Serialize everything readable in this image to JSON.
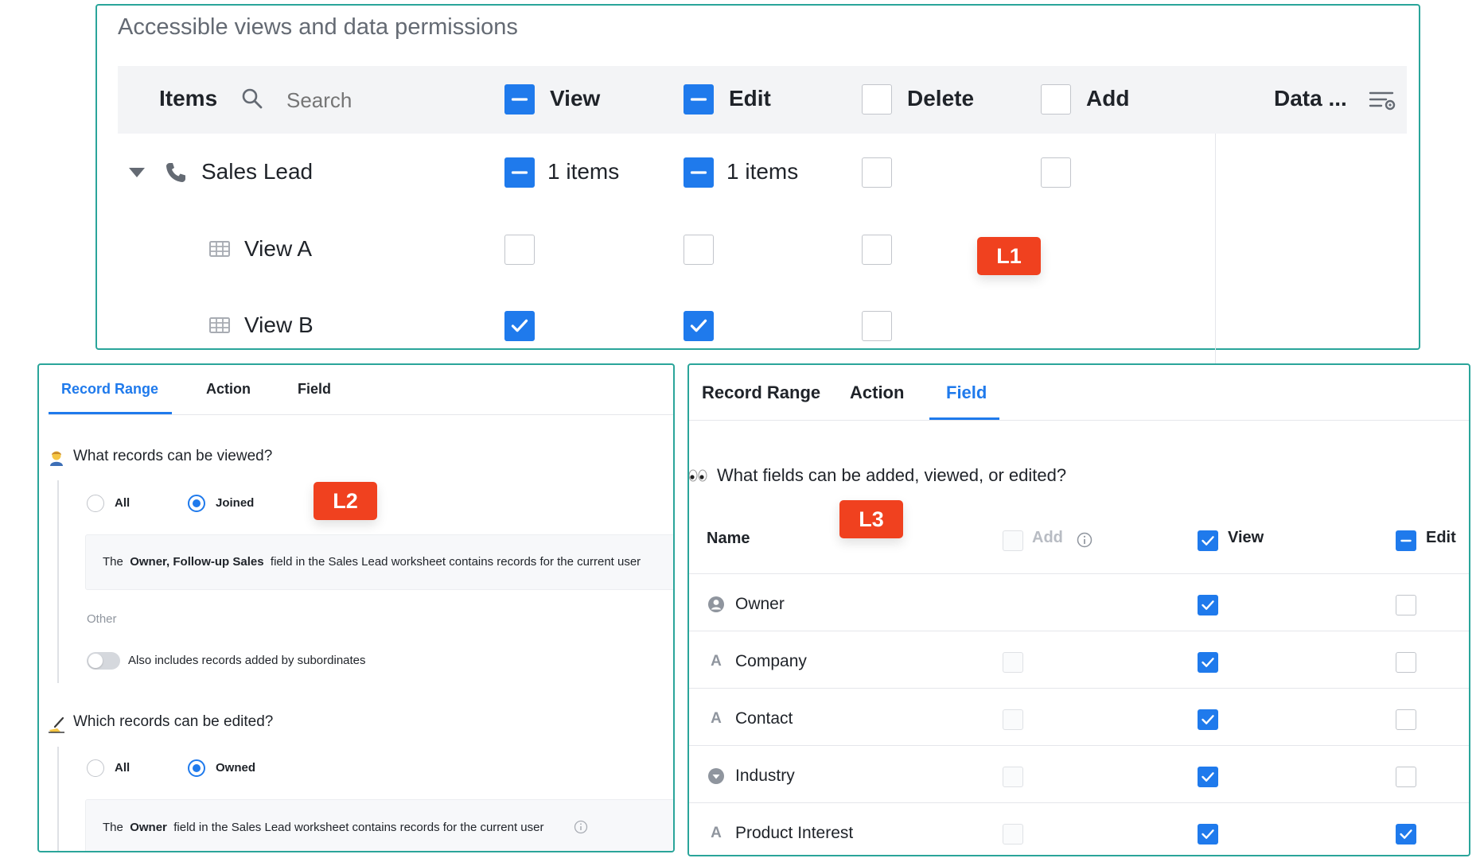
{
  "panel1": {
    "title": "Accessible views and data permissions",
    "header": {
      "items_label": "Items",
      "search_placeholder": "Search",
      "view_label": "View",
      "edit_label": "Edit",
      "delete_label": "Delete",
      "add_label": "Add",
      "data_label": "Data ..."
    },
    "rows": [
      {
        "label": "Sales Lead",
        "view_text": "1 items",
        "edit_text": "1 items"
      },
      {
        "label": "View A"
      },
      {
        "label": "View B"
      }
    ],
    "marker": "L1"
  },
  "panel2": {
    "tabs": [
      "Record Range",
      "Action",
      "Field"
    ],
    "active_tab": "Record Range",
    "q1": "What records can be viewed?",
    "q1_options": [
      "All",
      "Joined"
    ],
    "q1_selected": "Joined",
    "q1_info": {
      "prefix": "The",
      "bold": "Owner, Follow-up Sales",
      "suffix": "field in the Sales Lead worksheet contains records for the current user"
    },
    "other_label": "Other",
    "toggle_label": "Also includes records added by subordinates",
    "q2": "Which records can be edited?",
    "q2_options": [
      "All",
      "Owned"
    ],
    "q2_selected": "Owned",
    "q2_info": {
      "prefix": "The",
      "bold": "Owner",
      "suffix": "field in the Sales Lead worksheet contains records for the current user"
    },
    "marker": "L2"
  },
  "panel3": {
    "tabs": [
      "Record Range",
      "Action",
      "Field"
    ],
    "active_tab": "Field",
    "question": "What fields can be added, viewed, or edited?",
    "columns": {
      "name": "Name",
      "add": "Add",
      "view": "View",
      "edit": "Edit"
    },
    "fields": [
      {
        "name": "Owner",
        "icon": "person-icon",
        "add": null,
        "view": true,
        "edit": false
      },
      {
        "name": "Company",
        "icon": "text-field-icon",
        "add": false,
        "view": true,
        "edit": false
      },
      {
        "name": "Contact",
        "icon": "text-field-icon",
        "add": false,
        "view": true,
        "edit": false
      },
      {
        "name": "Industry",
        "icon": "dropdown-field-icon",
        "add": false,
        "view": true,
        "edit": false
      },
      {
        "name": "Product Interest",
        "icon": "text-field-icon",
        "add": false,
        "view": true,
        "edit": true
      }
    ],
    "marker": "L3"
  },
  "colors": {
    "accent": "#1f7aec",
    "frame": "#2aa59a",
    "marker": "#f0411f"
  }
}
